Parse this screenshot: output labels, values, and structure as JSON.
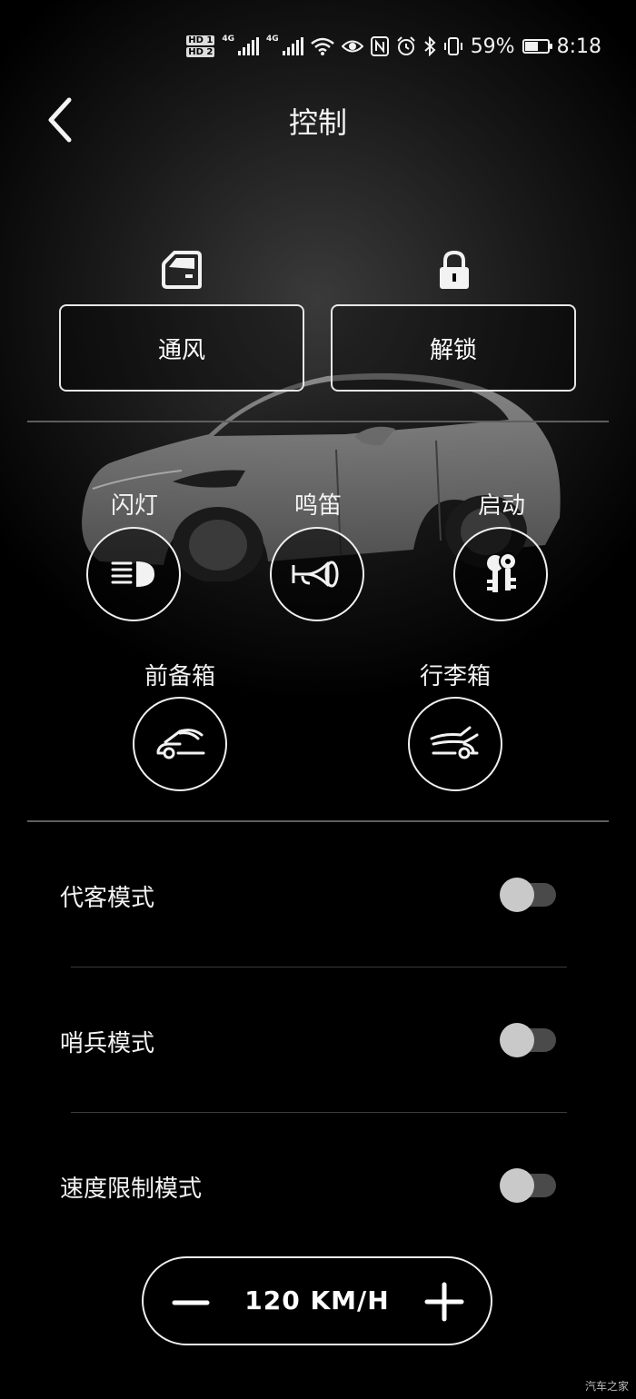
{
  "status_bar": {
    "hd1": "HD 1",
    "hd2": "HD 2",
    "network1": "4G",
    "network2": "4G",
    "battery": "59%",
    "battery_level": 0.59,
    "time": "8:18"
  },
  "header": {
    "title": "控制"
  },
  "quick_actions": [
    {
      "label": "通风",
      "icon": "window-icon"
    },
    {
      "label": "解锁",
      "icon": "lock-icon"
    }
  ],
  "controls": [
    {
      "label": "闪灯",
      "icon": "headlight-icon"
    },
    {
      "label": "鸣笛",
      "icon": "horn-icon"
    },
    {
      "label": "启动",
      "icon": "key-icon"
    },
    {
      "label": "前备箱",
      "icon": "frunk-icon"
    },
    {
      "label": "行李箱",
      "icon": "trunk-icon"
    }
  ],
  "toggles": [
    {
      "label": "代客模式",
      "on": false
    },
    {
      "label": "哨兵模式",
      "on": false
    },
    {
      "label": "速度限制模式",
      "on": false
    }
  ],
  "speed_limit": {
    "value": "120 KM/H"
  },
  "watermark": "汽车之家",
  "colors": {
    "background": "#000000",
    "foreground": "#ffffff",
    "toggle_off_track": "#4a4a4a",
    "toggle_knob": "#c9c9c9"
  }
}
